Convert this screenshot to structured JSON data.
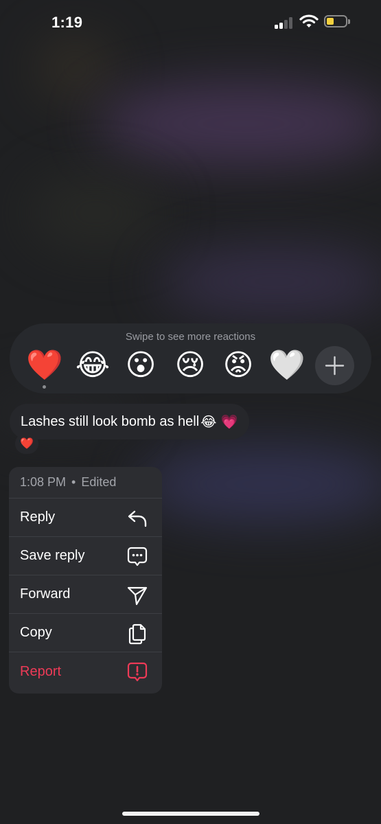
{
  "status_bar": {
    "time": "1:19",
    "battery_level": 0.25,
    "battery_color": "#f3d03e"
  },
  "reactions": {
    "hint": "Swipe to see more reactions",
    "items": [
      {
        "name": "red-heart",
        "glyph": "❤️",
        "selected": true
      },
      {
        "name": "tears-of-joy",
        "glyph": "😂"
      },
      {
        "name": "surprised",
        "glyph": "😮"
      },
      {
        "name": "crying",
        "glyph": "😢"
      },
      {
        "name": "angry",
        "glyph": "😡"
      },
      {
        "name": "white-heart",
        "glyph": "🤍"
      }
    ],
    "more_icon": "plus-icon"
  },
  "message": {
    "text": "Lashes still look bomb as hell",
    "emojis": "😂 💗",
    "reaction": "❤️"
  },
  "menu": {
    "header": {
      "time": "1:08 PM",
      "separator": "•",
      "edited": "Edited"
    },
    "items": [
      {
        "label": "Reply",
        "icon": "reply-icon"
      },
      {
        "label": "Save reply",
        "icon": "chat-bubble-icon"
      },
      {
        "label": "Forward",
        "icon": "send-icon"
      },
      {
        "label": "Copy",
        "icon": "copy-icon"
      },
      {
        "label": "Report",
        "icon": "report-icon",
        "danger": true
      }
    ]
  },
  "colors": {
    "danger": "#ee3a57",
    "menu_bg": "#2c2d31",
    "tray_bg": "#27292d"
  }
}
